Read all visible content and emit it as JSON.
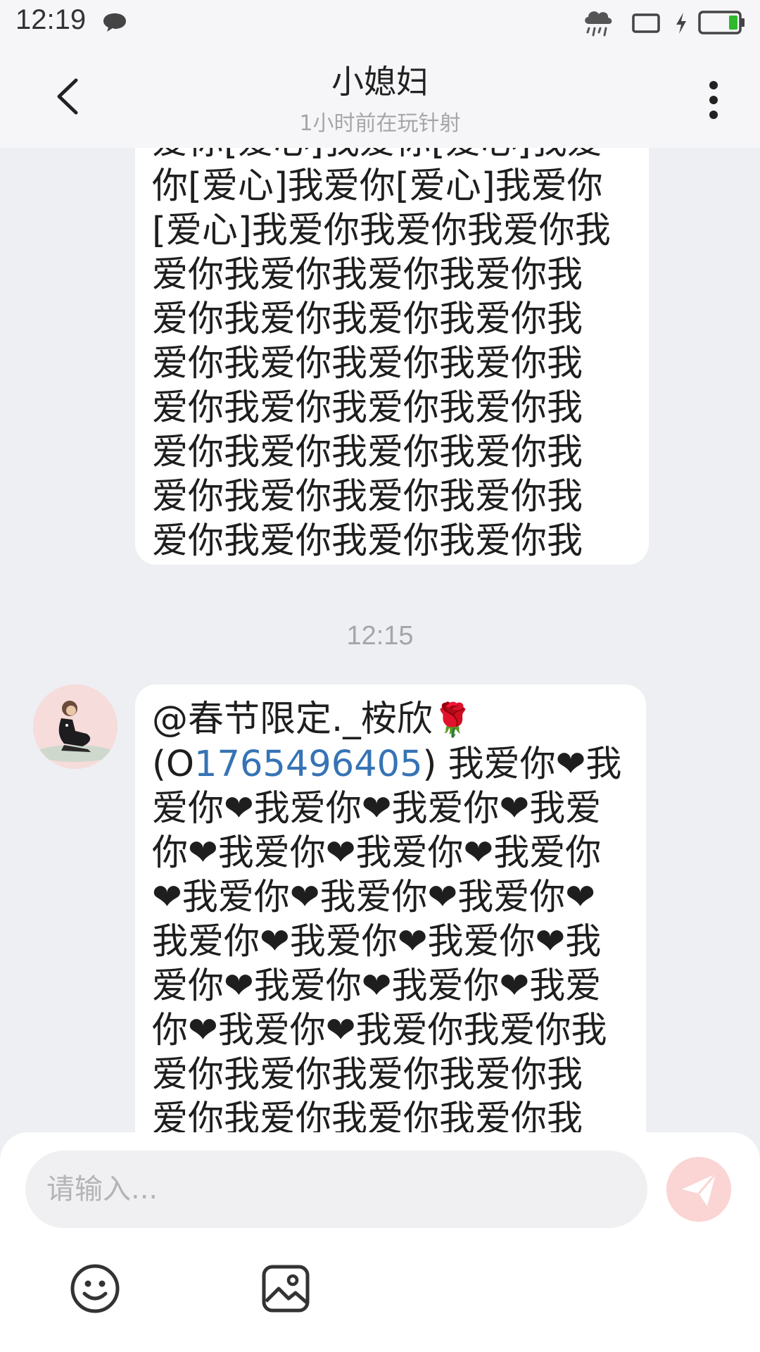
{
  "status_bar": {
    "time": "12:19",
    "icons": [
      "chat-bubble-icon",
      "weather-rain-icon",
      "tablet-icon",
      "charging-icon",
      "battery-icon"
    ],
    "battery_color": "#2db92d"
  },
  "header": {
    "title": "小媳妇",
    "subtitle": "1小时前在玩针射",
    "back_icon": "chevron-left-icon",
    "more_icon": "more-vertical-icon"
  },
  "messages": [
    {
      "lines": [
        "爱你[爱心]我爱你[爱心]我爱",
        "你[爱心]我爱你[爱心]我爱你",
        "[爱心]我爱你我爱你我爱你我",
        "爱你我爱你我爱你我爱你我",
        "爱你我爱你我爱你我爱你我",
        "爱你我爱你我爱你我爱你我",
        "爱你我爱你我爱你我爱你我",
        "爱你我爱你我爱你我爱你我",
        "爱你我爱你我爱你我爱你我",
        "爱你我爱你我爱你我爱你我"
      ]
    },
    {
      "timestamp": "12:15",
      "mention": "@春节限定._桉欣",
      "rose_emoji": "🌹",
      "paren_open": "(O",
      "phone": "1765496405",
      "paren_close": ") 我爱你❤我",
      "lines": [
        "爱你❤我爱你❤我爱你❤我爱",
        "你❤我爱你❤我爱你❤我爱你",
        "❤我爱你❤我爱你❤我爱你❤",
        "我爱你❤我爱你❤我爱你❤我",
        "爱你❤我爱你❤我爱你❤我爱",
        "你❤我爱你❤我爱你我爱你我",
        "爱你我爱你我爱你我爱你我",
        "爱你我爱你我爱你我爱你我"
      ]
    }
  ],
  "input": {
    "placeholder": "请输入...",
    "value": ""
  },
  "toolbar": {
    "emoji_icon": "smiley-icon",
    "image_icon": "image-icon",
    "send_icon": "send-icon"
  },
  "colors": {
    "background": "#eeeff3",
    "bubble": "#ffffff",
    "link": "#3673b5",
    "send_button": "#fbd4d4"
  }
}
